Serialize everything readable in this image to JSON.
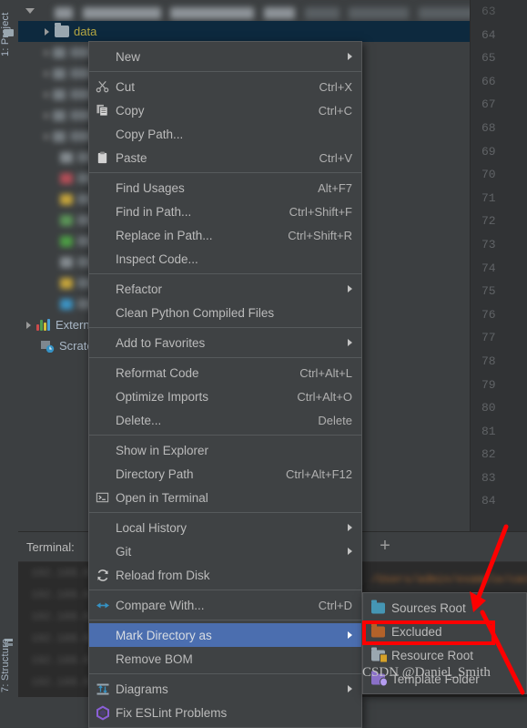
{
  "app": {
    "theme_bg": "#3c3f41",
    "accent_selection": "#4b6eaf",
    "tree_selection": "#0d293e",
    "annotation_color": "#fe0000"
  },
  "tool_window_tabs": {
    "project": "1: Project",
    "structure": "7: Structure"
  },
  "project_tree": {
    "root_label": "",
    "selected_item": "data",
    "items": [
      {
        "label": "data",
        "type": "directory",
        "selected": true
      },
      {
        "label": "External Libraries",
        "type": "libraries",
        "selected": false
      },
      {
        "label": "Scratches and Consoles",
        "type": "scratches",
        "selected": false
      }
    ],
    "external_libraries_label": "External Libraries",
    "scratches_label": "Scratches and Consoles"
  },
  "editor_gutter": {
    "line_numbers": [
      "63",
      "64",
      "65",
      "66",
      "67",
      "68",
      "69",
      "70",
      "71",
      "72",
      "73",
      "74",
      "75",
      "76",
      "77",
      "78",
      "79",
      "80",
      "81",
      "82",
      "83",
      "84"
    ]
  },
  "terminal": {
    "title": "Terminal:",
    "add_tab_label": "+",
    "lines": [
      "192.168.0.1",
      "192.168.0.1",
      "192.168.0.1",
      "192.168.0.1",
      "192.168.0.1",
      "192.168.0.1"
    ],
    "path_line": "/Users/admin/example/cache"
  },
  "context_menu": {
    "groups": [
      {
        "items": [
          {
            "label": "New",
            "accel": "",
            "submenu": true,
            "icon": "",
            "mnemonic": ""
          }
        ]
      },
      {
        "items": [
          {
            "label": "Cut",
            "accel": "Ctrl+X",
            "submenu": false,
            "icon": "scissors-icon",
            "mnemonic": "t"
          },
          {
            "label": "Copy",
            "accel": "Ctrl+C",
            "submenu": false,
            "icon": "copy-icon",
            "mnemonic": "C"
          },
          {
            "label": "Copy Path...",
            "accel": "",
            "submenu": false,
            "icon": "",
            "mnemonic": ""
          },
          {
            "label": "Paste",
            "accel": "Ctrl+V",
            "submenu": false,
            "icon": "clipboard-icon",
            "mnemonic": "P"
          }
        ]
      },
      {
        "items": [
          {
            "label": "Find Usages",
            "accel": "Alt+F7",
            "submenu": false,
            "icon": "",
            "mnemonic": "U"
          },
          {
            "label": "Find in Path...",
            "accel": "Ctrl+Shift+F",
            "submenu": false,
            "icon": "",
            "mnemonic": "P"
          },
          {
            "label": "Replace in Path...",
            "accel": "Ctrl+Shift+R",
            "submenu": false,
            "icon": "",
            "mnemonic": "a"
          },
          {
            "label": "Inspect Code...",
            "accel": "",
            "submenu": false,
            "icon": "",
            "mnemonic": "I"
          }
        ]
      },
      {
        "items": [
          {
            "label": "Refactor",
            "accel": "",
            "submenu": true,
            "icon": "",
            "mnemonic": "R"
          },
          {
            "label": "Clean Python Compiled Files",
            "accel": "",
            "submenu": false,
            "icon": "",
            "mnemonic": ""
          }
        ]
      },
      {
        "items": [
          {
            "label": "Add to Favorites",
            "accel": "",
            "submenu": true,
            "icon": "",
            "mnemonic": "F"
          }
        ]
      },
      {
        "items": [
          {
            "label": "Reformat Code",
            "accel": "Ctrl+Alt+L",
            "submenu": false,
            "icon": "",
            "mnemonic": "R"
          },
          {
            "label": "Optimize Imports",
            "accel": "Ctrl+Alt+O",
            "submenu": false,
            "icon": "",
            "mnemonic": "z"
          },
          {
            "label": "Delete...",
            "accel": "Delete",
            "submenu": false,
            "icon": "",
            "mnemonic": "D"
          }
        ]
      },
      {
        "items": [
          {
            "label": "Show in Explorer",
            "accel": "",
            "submenu": false,
            "icon": "",
            "mnemonic": ""
          },
          {
            "label": "Directory Path",
            "accel": "Ctrl+Alt+F12",
            "submenu": false,
            "icon": "",
            "mnemonic": "P"
          },
          {
            "label": "Open in Terminal",
            "accel": "",
            "submenu": false,
            "icon": "terminal-icon",
            "mnemonic": ""
          }
        ]
      },
      {
        "items": [
          {
            "label": "Local History",
            "accel": "",
            "submenu": true,
            "icon": "",
            "mnemonic": "H"
          },
          {
            "label": "Git",
            "accel": "",
            "submenu": true,
            "icon": "",
            "mnemonic": "G"
          },
          {
            "label": "Reload from Disk",
            "accel": "",
            "submenu": false,
            "icon": "refresh-icon",
            "mnemonic": ""
          }
        ]
      },
      {
        "items": [
          {
            "label": "Compare With...",
            "accel": "Ctrl+D",
            "submenu": false,
            "icon": "compare-icon",
            "mnemonic": ""
          }
        ]
      },
      {
        "items": [
          {
            "label": "Mark Directory as",
            "accel": "",
            "submenu": true,
            "icon": "",
            "mnemonic": "",
            "selected": true
          },
          {
            "label": "Remove BOM",
            "accel": "",
            "submenu": false,
            "icon": "",
            "mnemonic": ""
          }
        ]
      },
      {
        "items": [
          {
            "label": "Diagrams",
            "accel": "",
            "submenu": true,
            "icon": "diagram-icon",
            "mnemonic": ""
          },
          {
            "label": "Fix ESLint Problems",
            "accel": "",
            "submenu": false,
            "icon": "eslint-icon",
            "mnemonic": ""
          }
        ]
      }
    ]
  },
  "submenu_mark_directory_as": {
    "items": [
      {
        "label": "Sources Root",
        "icon": "sources-root-folder-icon",
        "color": "#4596b4",
        "highlighted": false
      },
      {
        "label": "Excluded",
        "icon": "excluded-folder-icon",
        "color": "#b3622a",
        "highlighted": true
      },
      {
        "label": "Resource Root",
        "icon": "resource-root-folder-icon",
        "color": "#9aa7b0",
        "highlighted": false
      },
      {
        "label": "Template Folder",
        "icon": "template-folder-icon",
        "color": "#8a70c8",
        "highlighted": false
      }
    ]
  },
  "annotations": {
    "watermark": "CSDN @Daniel_Smith",
    "watermark_prefix": "CSDN",
    "highlight_target": "Excluded"
  }
}
